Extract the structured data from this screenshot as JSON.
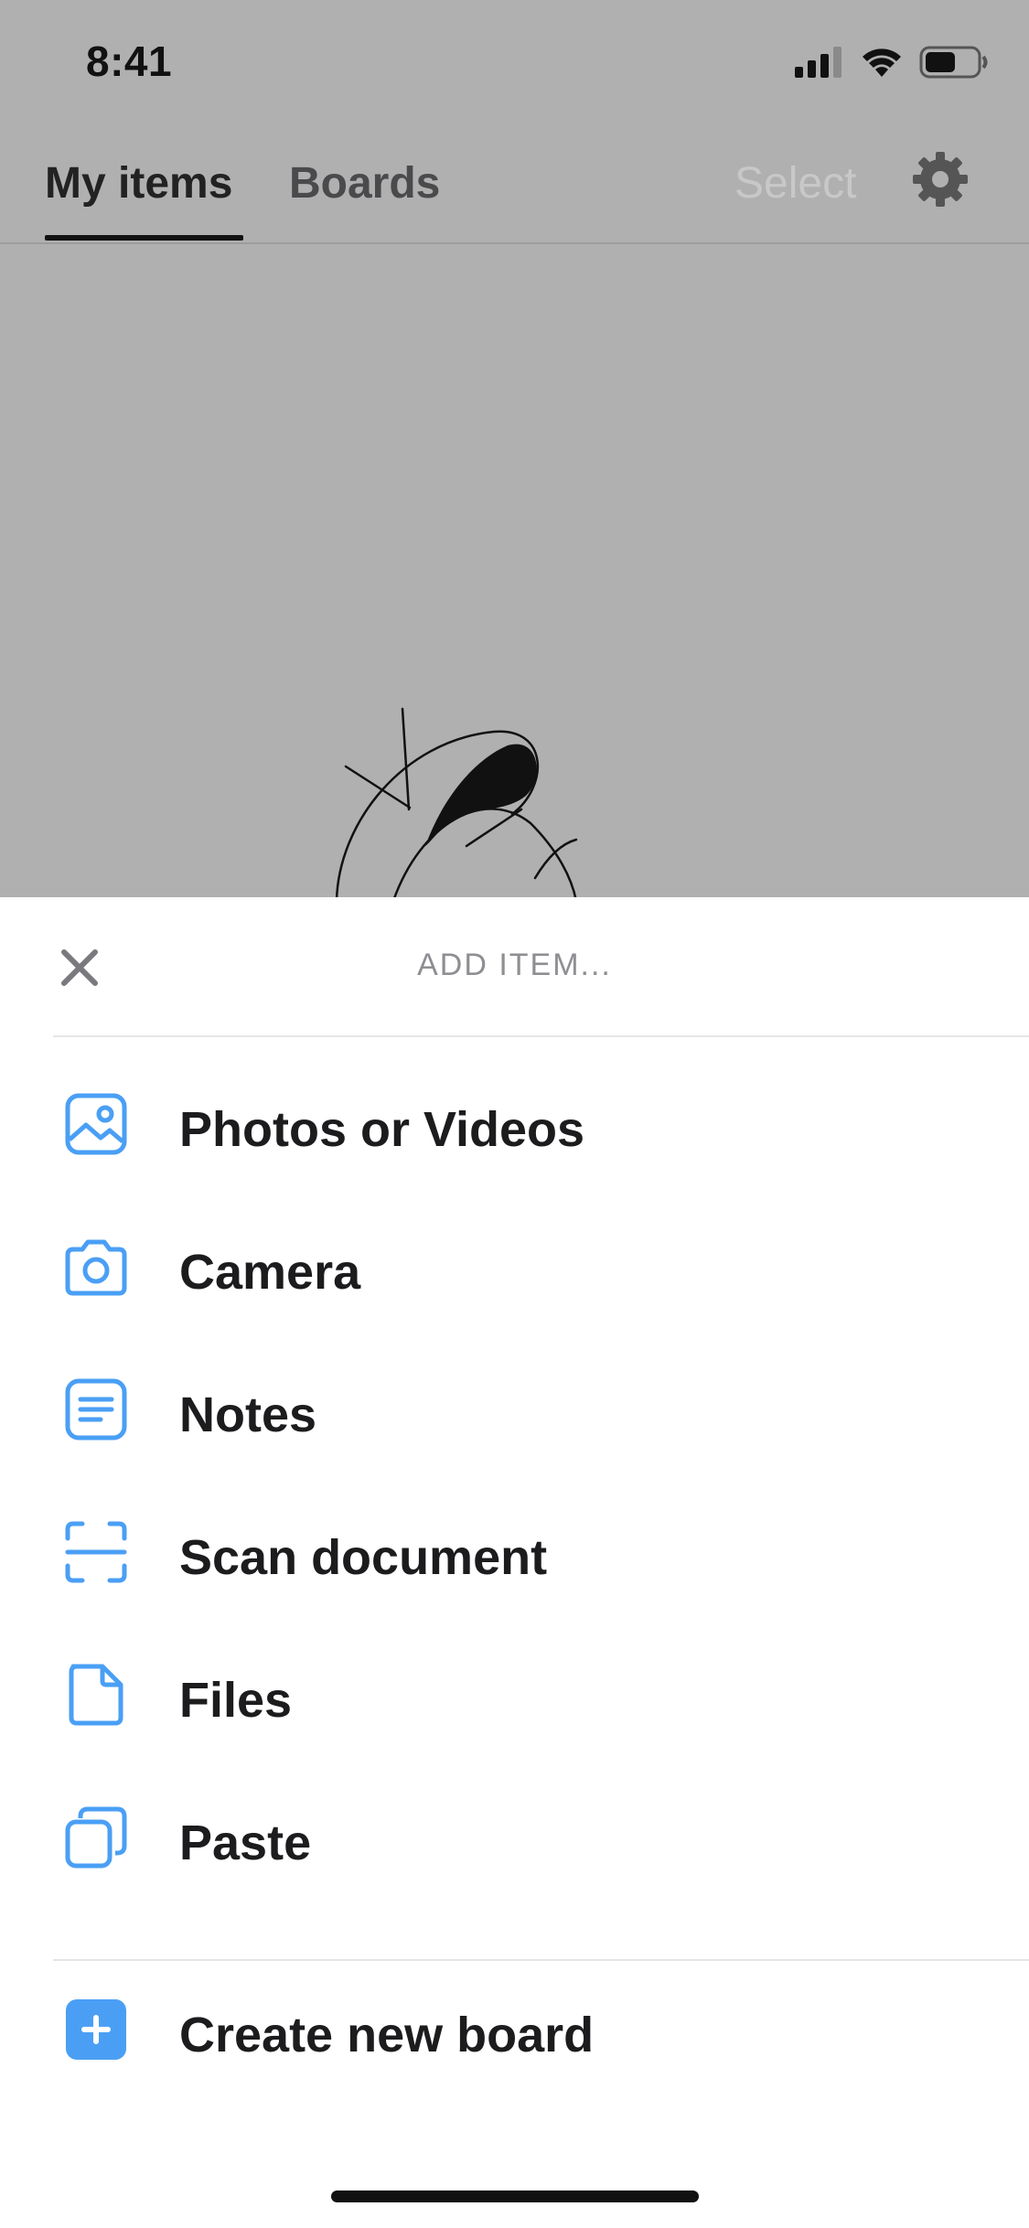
{
  "status_bar": {
    "time": "8:41"
  },
  "nav": {
    "tabs": [
      {
        "label": "My items",
        "active": true
      },
      {
        "label": "Boards",
        "active": false
      }
    ],
    "select_label": "Select"
  },
  "sheet": {
    "title": "ADD ITEM...",
    "items": [
      {
        "label": "Photos or Videos",
        "icon": "photo-icon"
      },
      {
        "label": "Camera",
        "icon": "camera-icon"
      },
      {
        "label": "Notes",
        "icon": "notes-icon"
      },
      {
        "label": "Scan document",
        "icon": "scan-icon"
      },
      {
        "label": "Files",
        "icon": "file-icon"
      },
      {
        "label": "Paste",
        "icon": "paste-icon"
      }
    ],
    "create_board_label": "Create new board"
  },
  "colors": {
    "accent": "#4a9ff5",
    "overlay": "#b0b0b0",
    "sheet_background": "#ffffff",
    "muted_text": "#8e8e93"
  }
}
